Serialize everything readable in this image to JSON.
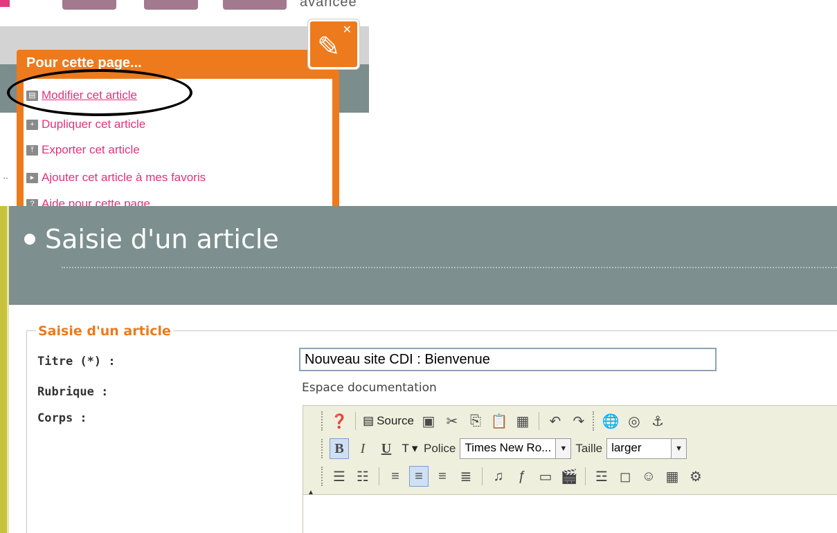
{
  "top": {
    "partial_word": "avancée"
  },
  "menu": {
    "title": "Pour cette page...",
    "items": [
      {
        "label": "Modifier cet article",
        "icon": "edit-icon"
      },
      {
        "label": "Dupliquer cet article",
        "icon": "plus-icon"
      },
      {
        "label": "Exporter cet article",
        "icon": "export-icon"
      },
      {
        "label": "Ajouter cet article à mes favoris",
        "icon": "play-icon"
      },
      {
        "label": "Aide pour cette page",
        "icon": "help-icon"
      }
    ]
  },
  "page": {
    "header_title": "Saisie d'un article"
  },
  "form": {
    "legend": "Saisie d'un article",
    "title_label": "Titre (*) :",
    "title_value": "Nouveau site CDI : Bienvenue",
    "rubrique_label": "Rubrique :",
    "rubrique_value": "Espace documentation",
    "corps_label": "Corps :"
  },
  "editor": {
    "source_label": "Source",
    "bold": "B",
    "italic": "I",
    "underline": "U",
    "text_color": "T",
    "font_label": "Police",
    "font_value": "Times New Ro...",
    "size_label": "Taille",
    "size_value": "larger"
  },
  "colors": {
    "accent_orange": "#ed7a1c",
    "link_pink": "#e0337a",
    "header_grey": "#7d8f8f"
  }
}
